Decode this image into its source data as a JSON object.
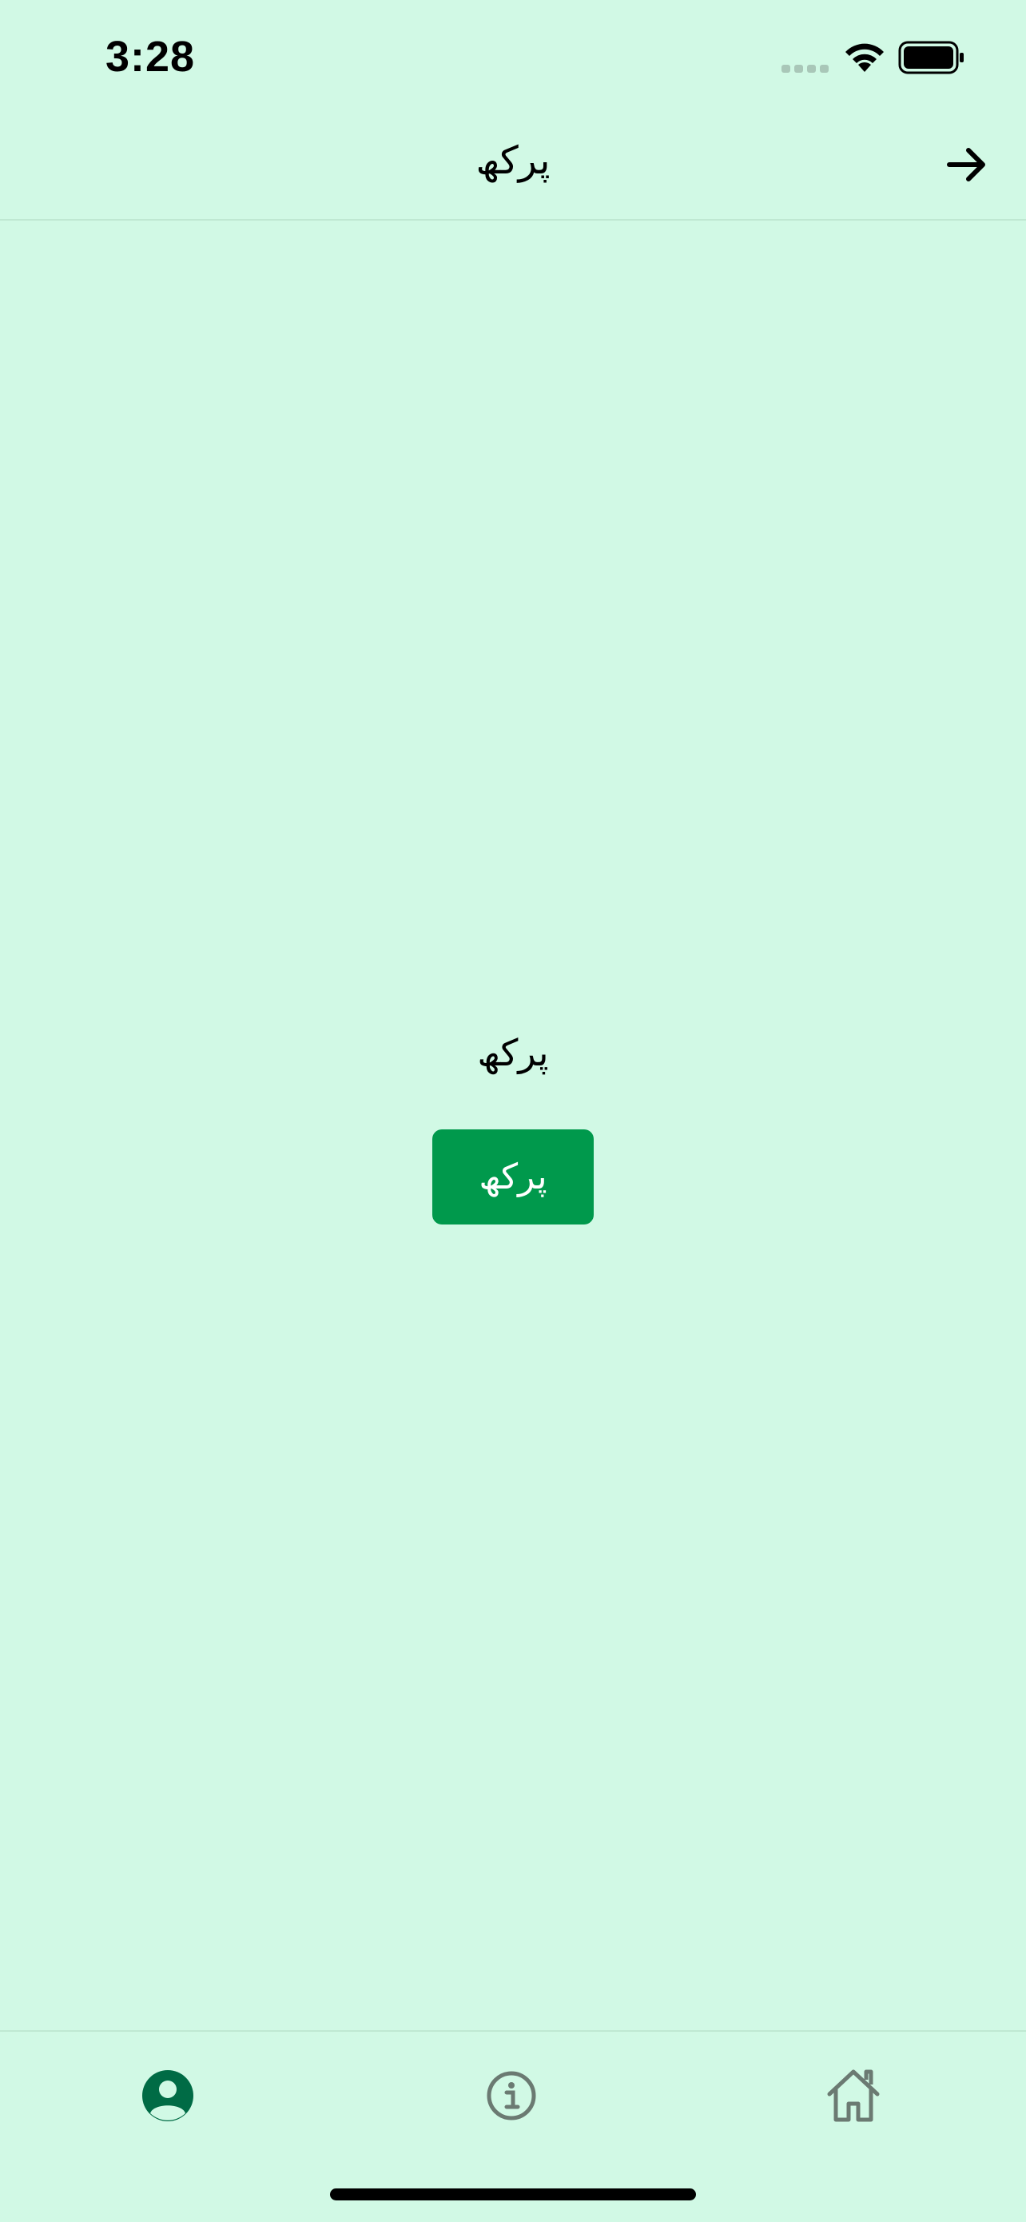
{
  "status_bar": {
    "time": "3:28",
    "signal_icon": "cellular-signal-icon",
    "wifi_icon": "wifi-icon",
    "battery_icon": "battery-icon"
  },
  "nav_bar": {
    "title": "پرکھ",
    "forward_icon": "arrow-right-icon"
  },
  "main": {
    "label": "پرکھ",
    "button_label": "پرکھ"
  },
  "tab_bar": {
    "items": [
      {
        "icon": "profile-icon",
        "selected": true
      },
      {
        "icon": "info-icon",
        "selected": false
      },
      {
        "icon": "home-icon",
        "selected": false
      }
    ]
  },
  "colors": {
    "background": "#d1f9e5",
    "button": "#00994c",
    "tab_active": "#006b45",
    "tab_inactive": "#6b7a72"
  }
}
